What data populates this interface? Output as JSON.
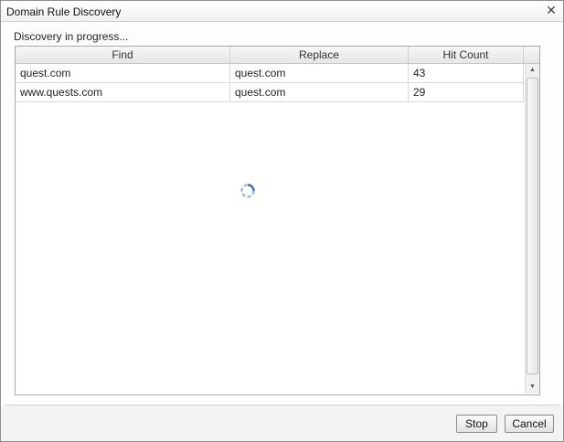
{
  "dialog": {
    "title": "Domain Rule Discovery",
    "close_icon": "close-icon"
  },
  "status": "Discovery in progress...",
  "table": {
    "columns": [
      "Find",
      "Replace",
      "Hit Count"
    ],
    "rows": [
      {
        "find": "quest.com",
        "replace": "quest.com",
        "hits": "43"
      },
      {
        "find": "www.quests.com",
        "replace": "quest.com",
        "hits": "29"
      }
    ]
  },
  "buttons": {
    "stop": "Stop",
    "cancel": "Cancel"
  }
}
